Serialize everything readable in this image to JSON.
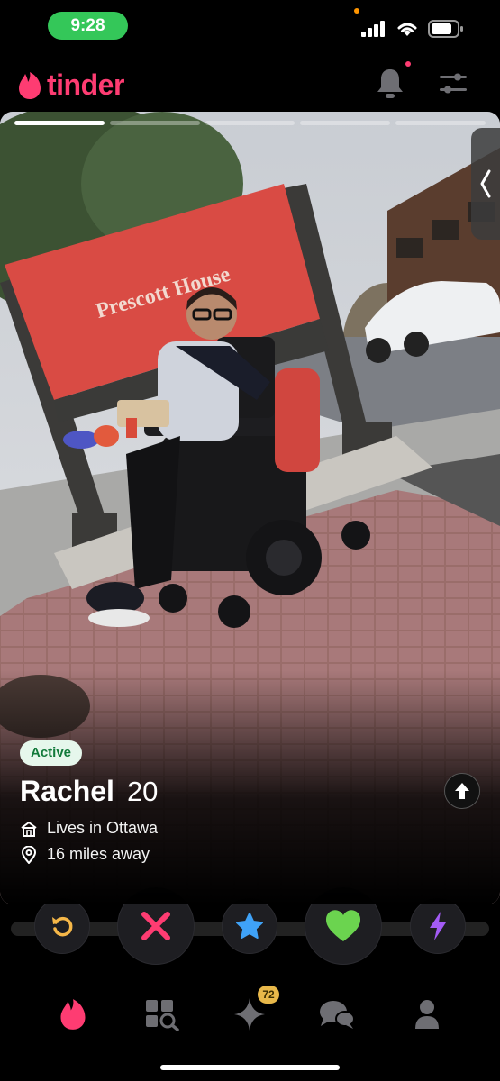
{
  "status_bar": {
    "time": "9:28"
  },
  "header": {
    "brand": "tinder",
    "brand_color": "#fe3c72",
    "bell_icon": "bell-icon",
    "filter_icon": "sliders-icon"
  },
  "card": {
    "photo_count": 5,
    "current_photo": 1,
    "photo_sign_text": "Prescott House",
    "active_badge": "Active",
    "name": "Rachel",
    "age": "20",
    "location": "Lives in Ottawa",
    "distance": "16 miles away"
  },
  "actions": [
    {
      "name": "rewind",
      "icon": "rewind-icon",
      "color": "#f5b748"
    },
    {
      "name": "nope",
      "icon": "x-icon",
      "color": "#fe3c72"
    },
    {
      "name": "super-like",
      "icon": "star-icon",
      "color": "#3fa2f7"
    },
    {
      "name": "like",
      "icon": "heart-icon",
      "color": "#6bd44f"
    },
    {
      "name": "boost",
      "icon": "lightning-icon",
      "color": "#a35bf5"
    }
  ],
  "nav": {
    "items": [
      "flame-icon",
      "explore-icon",
      "sparkle-icon",
      "chat-icon",
      "profile-icon"
    ],
    "likes_badge": "72"
  }
}
